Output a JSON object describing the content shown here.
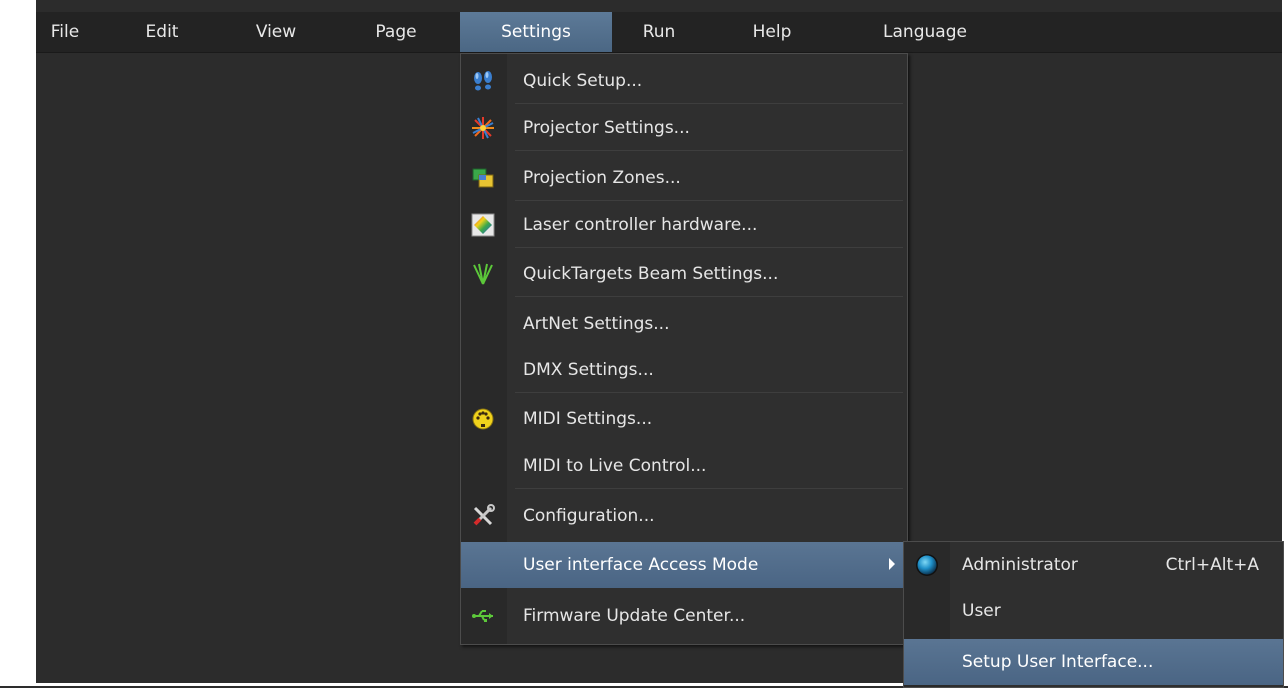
{
  "menubar": {
    "items": [
      {
        "label": "File"
      },
      {
        "label": "Edit"
      },
      {
        "label": "View"
      },
      {
        "label": "Page"
      },
      {
        "label": "Settings"
      },
      {
        "label": "Run"
      },
      {
        "label": "Help"
      },
      {
        "label": "Language"
      }
    ],
    "active": "Settings"
  },
  "settings_menu": {
    "items": [
      {
        "label": "Quick Setup...",
        "icon": "footsteps-icon"
      },
      {
        "label": "Projector Settings...",
        "icon": "laser-burst-icon"
      },
      {
        "label": "Projection Zones...",
        "icon": "zones-icon"
      },
      {
        "label": "Laser controller hardware...",
        "icon": "color-diamond-icon"
      },
      {
        "label": "QuickTargets Beam Settings...",
        "icon": "beams-icon"
      },
      {
        "label": "ArtNet Settings...",
        "icon": ""
      },
      {
        "label": "DMX Settings...",
        "icon": ""
      },
      {
        "label": "MIDI Settings...",
        "icon": "midi-connector-icon"
      },
      {
        "label": "MIDI to Live Control...",
        "icon": ""
      },
      {
        "label": "Configuration...",
        "icon": "tools-icon"
      },
      {
        "label": "User interface Access Mode",
        "icon": "",
        "has_submenu": true
      },
      {
        "label": "Firmware Update Center...",
        "icon": "usb-icon"
      }
    ]
  },
  "access_mode_submenu": {
    "items": [
      {
        "label": "Administrator",
        "shortcut": "Ctrl+Alt+A",
        "icon": "radio-selected-icon"
      },
      {
        "label": "User",
        "shortcut": ""
      },
      {
        "label": "Setup User Interface...",
        "shortcut": ""
      }
    ]
  },
  "colors": {
    "highlight": "#4f6b89",
    "menubar_bg": "#232323",
    "menu_bg": "#2f2f2f"
  }
}
